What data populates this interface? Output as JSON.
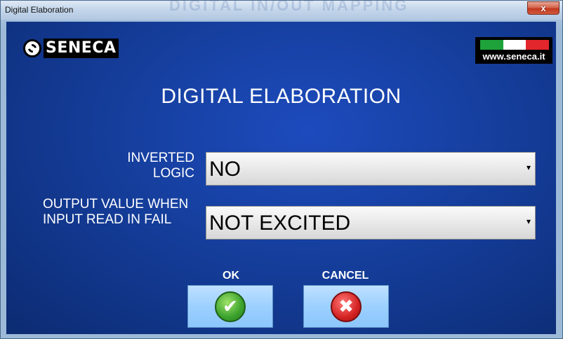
{
  "window": {
    "title": "Digital Elaboration",
    "background_text": "DIGITAL IN/OUT MAPPING",
    "close_label": "x"
  },
  "brand": {
    "logo_text": "SENECA",
    "logo_icon": "seneca-logo-icon",
    "site_text": "www.seneca.it",
    "flag_colors": [
      "#1ea33a",
      "#ffffff",
      "#e3262b"
    ]
  },
  "heading": "DIGITAL ELABORATION",
  "fields": {
    "inverted_logic": {
      "label": "INVERTED LOGIC",
      "value": "NO"
    },
    "output_value": {
      "label": "OUTPUT VALUE WHEN INPUT READ IN FAIL",
      "value": "NOT EXCITED"
    }
  },
  "buttons": {
    "ok_label": "OK",
    "ok_icon": "check-icon",
    "ok_glyph": "✔",
    "cancel_label": "CANCEL",
    "cancel_icon": "x-icon",
    "cancel_glyph": "✖"
  },
  "colors": {
    "panel_blue": "#153e9c",
    "ok_green": "#3aa12c",
    "cancel_red": "#d42222"
  }
}
